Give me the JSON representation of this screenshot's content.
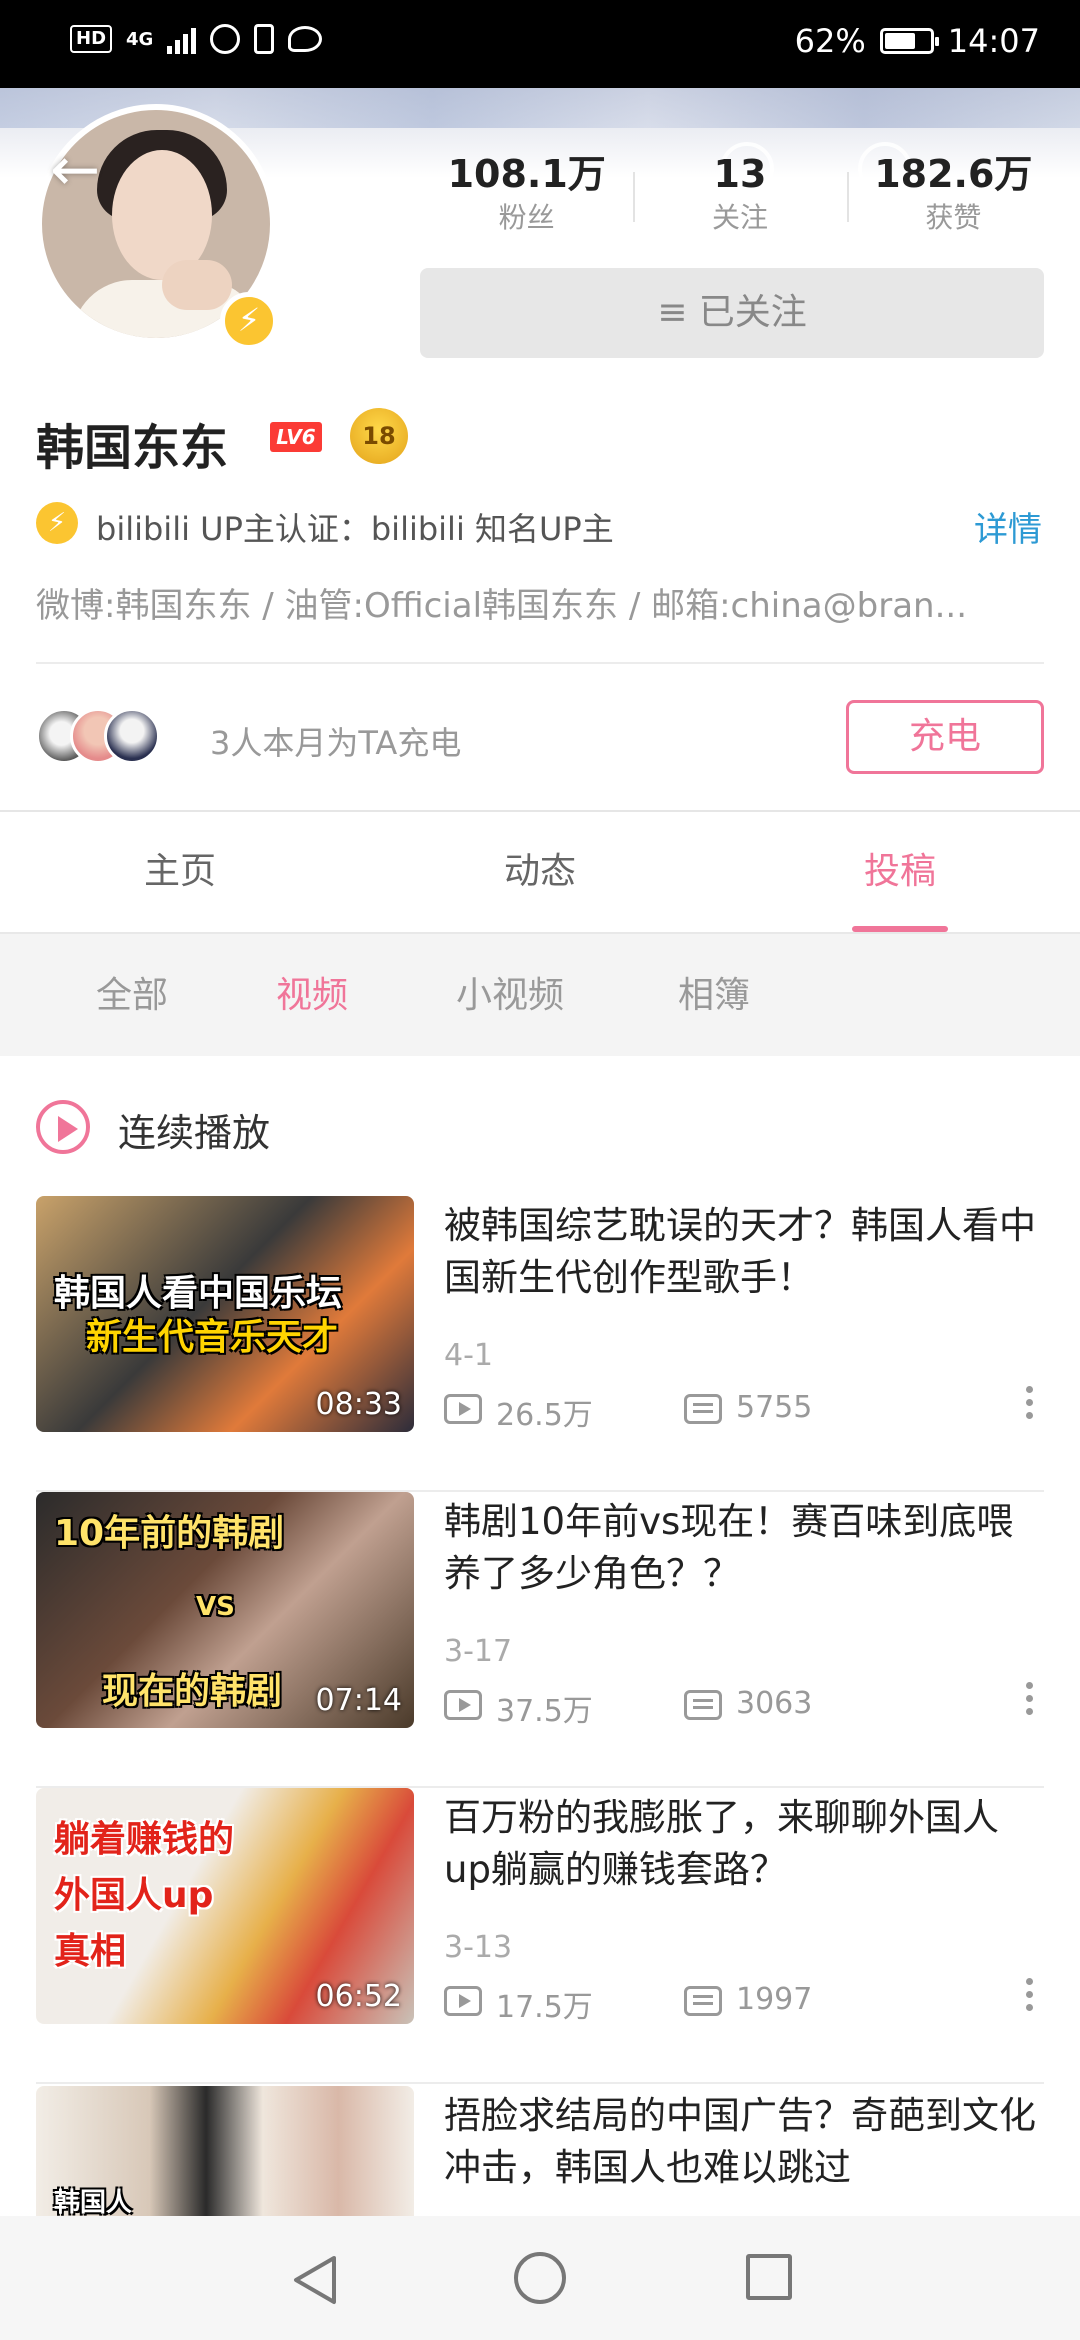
{
  "status_bar": {
    "battery": "62%",
    "battery_level": 0.62,
    "time": "14:07",
    "network": "4G",
    "hd": "HD"
  },
  "profile": {
    "name": "韩国东东",
    "level_badge": "LV6",
    "medal_text": "18",
    "stats": [
      {
        "value": "108.1万",
        "label": "粉丝"
      },
      {
        "value": "13",
        "label": "关注"
      },
      {
        "value": "182.6万",
        "label": "获赞"
      }
    ],
    "follow_button": "≡ 已关注",
    "certification": "bilibili UP主认证：bilibili 知名UP主",
    "certification_more": "详情",
    "signature": "微博:韩国东东 / 油管:Official韩国东东 / 邮箱:china@bran...",
    "charge_text": "3人本月为TA充电",
    "charge_button": "充电"
  },
  "tabs": [
    {
      "label": "主页",
      "active": false
    },
    {
      "label": "动态",
      "active": false
    },
    {
      "label": "投稿",
      "active": true
    }
  ],
  "subtabs": [
    {
      "label": "全部",
      "active": false
    },
    {
      "label": "视频",
      "active": true
    },
    {
      "label": "小视频",
      "active": false
    },
    {
      "label": "相簿",
      "active": false
    }
  ],
  "continuous_play": "连续播放",
  "videos": [
    {
      "title": "被韩国综艺耽误的天才？韩国人看中国新生代创作型歌手！",
      "date": "4-1",
      "views": "26.5万",
      "comments": "5755",
      "duration": "08:33",
      "thumb_caption_1": "韩国人看中国乐坛",
      "thumb_caption_2": "新生代音乐天才"
    },
    {
      "title": "韩剧10年前vs现在！赛百味到底喂养了多少角色？？",
      "date": "3-17",
      "views": "37.5万",
      "comments": "3063",
      "duration": "07:14",
      "thumb_caption_1": "10年前的韩剧",
      "thumb_caption_2": "VS",
      "thumb_caption_3": "现在的韩剧"
    },
    {
      "title": "百万粉的我膨胀了，来聊聊外国人up躺赢的赚钱套路？",
      "date": "3-13",
      "views": "17.5万",
      "comments": "1997",
      "duration": "06:52",
      "thumb_caption_1": "躺着赚钱的",
      "thumb_caption_2": "外国人up",
      "thumb_caption_3": "真相"
    },
    {
      "title": "捂脸求结局的中国广告？奇葩到文化冲击，韩国人也难以跳过",
      "thumb_caption_1": "韩国人"
    }
  ],
  "colors": {
    "accent_pink": "#f07599",
    "link_blue": "#2d9ad4",
    "lv_red": "#fb3b35",
    "verify_yellow": "#fbc531"
  }
}
